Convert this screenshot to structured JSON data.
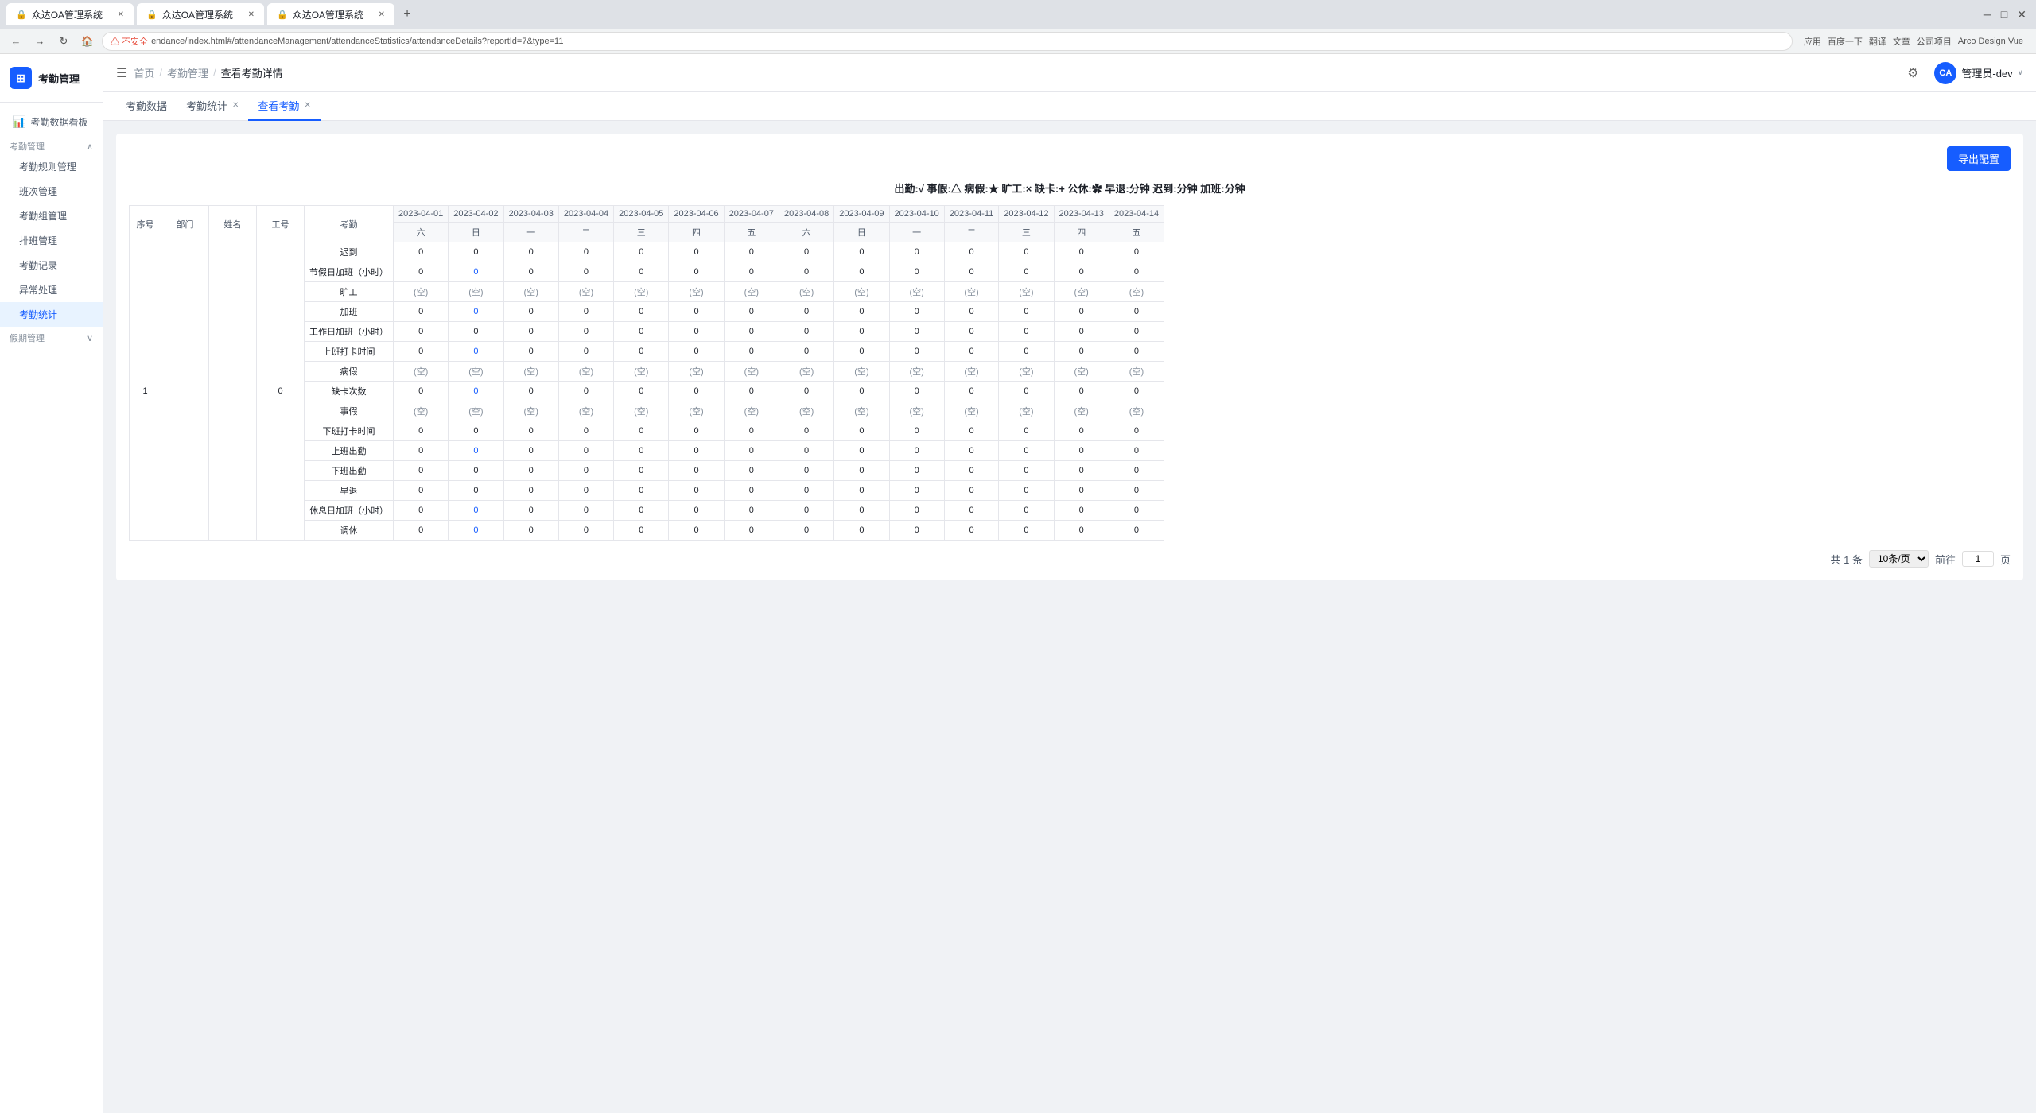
{
  "browser": {
    "tabs": [
      {
        "label": "众达OA管理系统",
        "active": false
      },
      {
        "label": "众达OA管理系统",
        "active": false
      },
      {
        "label": "众达OA管理系统",
        "active": true
      }
    ],
    "url": "endance/index.html#/attendanceManagement/attendanceStatistics/attendanceDetails?reportId=7&type=11",
    "bookmarks": [
      "应用",
      "百度一下",
      "翻译",
      "文章",
      "公司项目",
      "Arco Design Vue"
    ]
  },
  "sidebar": {
    "title": "考勤管理",
    "logo_text": "☰",
    "menu_groups": [
      {
        "id": "dashboard",
        "label": "考勤数据看板",
        "icon": "📊",
        "type": "item"
      },
      {
        "id": "attendance",
        "label": "考勤管理",
        "icon": "📋",
        "type": "group",
        "expanded": true,
        "children": [
          {
            "id": "rules",
            "label": "考勤规则管理"
          },
          {
            "id": "shifts",
            "label": "班次管理"
          },
          {
            "id": "manage",
            "label": "考勤组管理"
          },
          {
            "id": "scheduling",
            "label": "排班管理"
          },
          {
            "id": "records",
            "label": "考勤记录"
          },
          {
            "id": "exceptions",
            "label": "异常处理"
          },
          {
            "id": "stats",
            "label": "考勤统计",
            "active": true
          }
        ]
      },
      {
        "id": "leave",
        "label": "假期管理",
        "icon": "🏖",
        "type": "group",
        "expanded": false
      }
    ]
  },
  "topbar": {
    "hamburger": "☰",
    "breadcrumbs": [
      "首页",
      "考勤管理",
      "查看考勤详情"
    ],
    "settings_icon": "⚙",
    "user": {
      "initials": "CA",
      "name": "管理员-dev",
      "avatar_color": "#165dff"
    }
  },
  "page_tabs": [
    {
      "label": "考勤数据",
      "closable": false,
      "active": false
    },
    {
      "label": "考勤统计",
      "closable": true,
      "active": false
    },
    {
      "label": "查看考勤",
      "closable": true,
      "active": true
    }
  ],
  "content": {
    "export_button": "导出配置",
    "legend": {
      "items": [
        {
          "symbol": "√",
          "label": "出勤:"
        },
        {
          "symbol": "△",
          "label": "事假:"
        },
        {
          "symbol": "★",
          "label": "病假:"
        },
        {
          "symbol": "×",
          "label": "旷工:"
        },
        {
          "symbol": "+",
          "label": "缺卡:"
        },
        {
          "symbol": "✿",
          "label": "公休:"
        },
        {
          "symbol": "分钟",
          "label": "早退:"
        },
        {
          "symbol": "分钟",
          "label": "迟到:"
        },
        {
          "symbol": "分钟",
          "label": "加班:"
        }
      ],
      "display": "出勤:√  事假:△  病假:★  旷工:×  缺卡:+  公休:✿  早退:分钟  迟到:分钟  加班:分钟"
    },
    "table": {
      "fixed_headers": [
        "序号",
        "部门",
        "姓名",
        "工号",
        "考勤"
      ],
      "date_columns": [
        {
          "date": "2023-04-01",
          "day": "六"
        },
        {
          "date": "2023-04-02",
          "day": "日"
        },
        {
          "date": "2023-04-03",
          "day": "一"
        },
        {
          "date": "2023-04-04",
          "day": "二"
        },
        {
          "date": "2023-04-05",
          "day": "三"
        },
        {
          "date": "2023-04-06",
          "day": "四"
        },
        {
          "date": "2023-04-07",
          "day": "五"
        },
        {
          "date": "2023-04-08",
          "day": "六"
        },
        {
          "date": "2023-04-09",
          "day": "日"
        },
        {
          "date": "2023-04-10",
          "day": "一"
        },
        {
          "date": "2023-04-11",
          "day": "二"
        },
        {
          "date": "2023-04-12",
          "day": "三"
        },
        {
          "date": "2023-04-13",
          "day": "四"
        },
        {
          "date": "2023-04-14",
          "day": "五"
        }
      ],
      "row_labels": [
        "迟到",
        "节假日加班（小时）",
        "旷工",
        "加班",
        "工作日加班（小时）",
        "上班打卡时间",
        "病假",
        "缺卡次数",
        "事假",
        "下班打卡时间",
        "上班出勤",
        "下班出勤",
        "早退",
        "休息日加班（小时）",
        "调休"
      ],
      "data_row": {
        "seq": "1",
        "dept": "",
        "name": "",
        "emp_id": "0",
        "values": {
          "迟到": [
            "0",
            "0",
            "0",
            "0",
            "0",
            "0",
            "0",
            "0",
            "0",
            "0",
            "0",
            "0",
            "0",
            "0"
          ],
          "节假日加班（小时）": [
            "0",
            "0*",
            "0",
            "0",
            "0",
            "0",
            "0",
            "0",
            "0",
            "0",
            "0",
            "0",
            "0",
            "0"
          ],
          "旷工": [
            "(空)",
            "(空)",
            "(空)",
            "(空)",
            "(空)",
            "(空)",
            "(空)",
            "(空)",
            "(空)",
            "(空)",
            "(空)",
            "(空)",
            "(空)",
            "(空)"
          ],
          "加班": [
            "0",
            "0*",
            "0",
            "0",
            "0",
            "0",
            "0",
            "0",
            "0",
            "0",
            "0",
            "0",
            "0",
            "0"
          ],
          "工作日加班（小时）": [
            "0",
            "0",
            "0",
            "0",
            "0",
            "0",
            "0",
            "0",
            "0",
            "0",
            "0",
            "0",
            "0",
            "0"
          ],
          "上班打卡时间": [
            "0",
            "0*",
            "0",
            "0",
            "0",
            "0",
            "0",
            "0",
            "0",
            "0",
            "0",
            "0",
            "0",
            "0"
          ],
          "病假": [
            "(空)",
            "(空)",
            "(空)",
            "(空)",
            "(空)",
            "(空)",
            "(空)",
            "(空)",
            "(空)",
            "(空)",
            "(空)",
            "(空)",
            "(空)",
            "(空)"
          ],
          "缺卡次数": [
            "0",
            "0*",
            "0",
            "0",
            "0",
            "0",
            "0",
            "0",
            "0",
            "0",
            "0",
            "0",
            "0",
            "0"
          ],
          "事假": [
            "(空)",
            "(空)",
            "(空)",
            "(空)",
            "(空)",
            "(空)",
            "(空)",
            "(空)",
            "(空)",
            "(空)",
            "(空)",
            "(空)",
            "(空)",
            "(空)"
          ],
          "下班打卡时间": [
            "0",
            "0",
            "0",
            "0",
            "0",
            "0",
            "0",
            "0",
            "0",
            "0",
            "0",
            "0",
            "0",
            "0"
          ],
          "上班出勤": [
            "0",
            "0*",
            "0",
            "0",
            "0",
            "0",
            "0",
            "0",
            "0",
            "0",
            "0",
            "0",
            "0",
            "0"
          ],
          "下班出勤": [
            "0",
            "0",
            "0",
            "0",
            "0",
            "0",
            "0",
            "0",
            "0",
            "0",
            "0",
            "0",
            "0",
            "0"
          ],
          "早退": [
            "0",
            "0",
            "0",
            "0",
            "0",
            "0",
            "0",
            "0",
            "0",
            "0",
            "0",
            "0",
            "0",
            "0"
          ],
          "休息日加班（小时）": [
            "0",
            "0*",
            "0",
            "0",
            "0",
            "0",
            "0",
            "0",
            "0",
            "0",
            "0",
            "0",
            "0",
            "0"
          ],
          "调休": [
            "0",
            "0*",
            "0",
            "0",
            "0",
            "0",
            "0",
            "0",
            "0",
            "0",
            "0",
            "0",
            "0",
            "0"
          ]
        }
      }
    },
    "pagination": {
      "total_text": "共 1 条",
      "per_page": "10条/页",
      "current_page": "1",
      "prev_label": "前往",
      "total_pages": "1",
      "page_unit": "页"
    }
  },
  "colors": {
    "primary": "#165dff",
    "border": "#e5e6eb",
    "bg": "#f7f8fa",
    "blue_val": "#165dff",
    "text_muted": "#86909c"
  }
}
